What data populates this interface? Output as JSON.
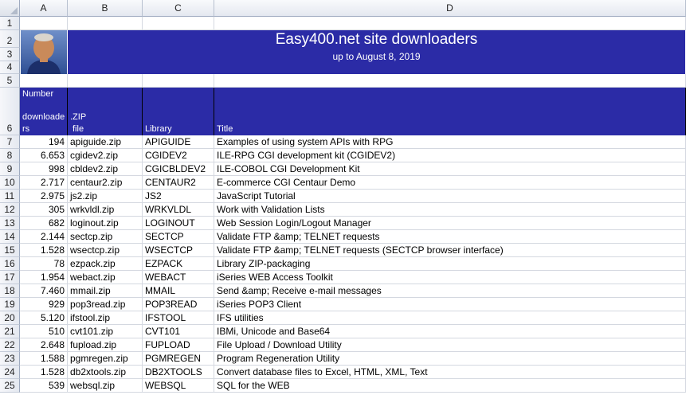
{
  "columns": [
    "A",
    "B",
    "C",
    "D"
  ],
  "banner": {
    "title": "Easy400.net site downloaders",
    "subtitle": "up to August 8, 2019"
  },
  "header": {
    "number_line1": "Number",
    "number_line2": "downloade",
    "number_line3": "rs",
    "zip_line1": ".ZIP",
    "zip_line2": "file",
    "library": "Library",
    "title": "Title"
  },
  "rows": [
    {
      "n": "7",
      "count": "194",
      "zip": "apiguide.zip",
      "lib": "APIGUIDE",
      "title": "Examples of using system APIs with RPG"
    },
    {
      "n": "8",
      "count": "6.653",
      "zip": "cgidev2.zip",
      "lib": "CGIDEV2",
      "title": "ILE-RPG CGI development kit (CGIDEV2)"
    },
    {
      "n": "9",
      "count": "998",
      "zip": "cbldev2.zip",
      "lib": "CGICBLDEV2",
      "title": "ILE-COBOL CGI Development Kit"
    },
    {
      "n": "10",
      "count": "2.717",
      "zip": "centaur2.zip",
      "lib": "CENTAUR2",
      "title": "E-commerce CGI Centaur Demo"
    },
    {
      "n": "11",
      "count": "2.975",
      "zip": "js2.zip",
      "lib": "JS2",
      "title": "JavaScript Tutorial"
    },
    {
      "n": "12",
      "count": "305",
      "zip": "wrkvldl.zip",
      "lib": "WRKVLDL",
      "title": "Work with Validation Lists"
    },
    {
      "n": "13",
      "count": "682",
      "zip": "loginout.zip",
      "lib": "LOGINOUT",
      "title": "Web Session Login/Logout Manager"
    },
    {
      "n": "14",
      "count": "2.144",
      "zip": "sectcp.zip",
      "lib": "SECTCP",
      "title": "Validate FTP &amp; TELNET requests"
    },
    {
      "n": "15",
      "count": "1.528",
      "zip": "wsectcp.zip",
      "lib": "WSECTCP",
      "title": "Validate FTP &amp; TELNET requests (SECTCP browser interface)"
    },
    {
      "n": "16",
      "count": "78",
      "zip": "ezpack.zip",
      "lib": "EZPACK",
      "title": "Library ZIP-packaging"
    },
    {
      "n": "17",
      "count": "1.954",
      "zip": "webact.zip",
      "lib": "WEBACT",
      "title": "iSeries WEB Access Toolkit"
    },
    {
      "n": "18",
      "count": "7.460",
      "zip": "mmail.zip",
      "lib": "MMAIL",
      "title": "Send &amp; Receive e-mail messages"
    },
    {
      "n": "19",
      "count": "929",
      "zip": "pop3read.zip",
      "lib": "POP3READ",
      "title": "iSeries POP3 Client"
    },
    {
      "n": "20",
      "count": "5.120",
      "zip": "ifstool.zip",
      "lib": "IFSTOOL",
      "title": "IFS utilities"
    },
    {
      "n": "21",
      "count": "510",
      "zip": "cvt101.zip",
      "lib": "CVT101",
      "title": "IBMi, Unicode and Base64"
    },
    {
      "n": "22",
      "count": "2.648",
      "zip": "fupload.zip",
      "lib": "FUPLOAD",
      "title": "File Upload / Download Utility"
    },
    {
      "n": "23",
      "count": "1.588",
      "zip": "pgmregen.zip",
      "lib": "PGMREGEN",
      "title": "Program Regeneration Utility"
    },
    {
      "n": "24",
      "count": "1.528",
      "zip": "db2xtools.zip",
      "lib": "DB2XTOOLS",
      "title": "Convert database files to Excel, HTML, XML, Text"
    },
    {
      "n": "25",
      "count": "539",
      "zip": "websql.zip",
      "lib": "WEBSQL",
      "title": "SQL for the WEB"
    }
  ],
  "colors": {
    "banner": "#2b2ba6",
    "grid": "#d4d8e0"
  },
  "icons": {
    "photo": "person-photo-icon"
  }
}
